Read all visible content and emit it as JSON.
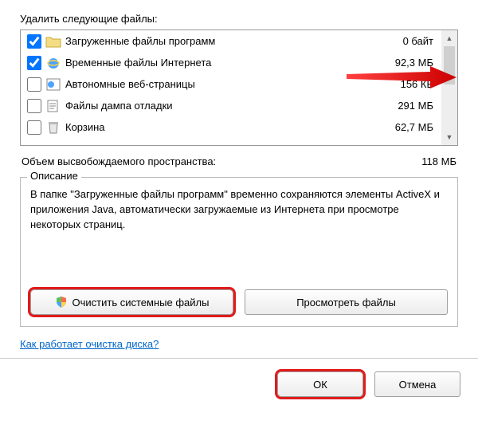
{
  "heading": "Удалить следующие файлы:",
  "files": [
    {
      "checked": true,
      "icon": "folder",
      "name": "Загруженные файлы программ",
      "size": "0 байт"
    },
    {
      "checked": true,
      "icon": "ie",
      "name": "Временные файлы Интернета",
      "size": "92,3 МБ"
    },
    {
      "checked": false,
      "icon": "web",
      "name": "Автономные веб-страницы",
      "size": "156 КБ"
    },
    {
      "checked": false,
      "icon": "dump",
      "name": "Файлы дампа отладки",
      "size": "291 МБ"
    },
    {
      "checked": false,
      "icon": "bin",
      "name": "Корзина",
      "size": "62,7 МБ"
    }
  ],
  "free_label": "Объем высвобождаемого пространства:",
  "free_value": "118 МБ",
  "group_title": "Описание",
  "description": "В папке \"Загруженные файлы программ\" временно сохраняются элементы ActiveX и приложения Java, автоматически загружаемые из Интернета при просмотре некоторых страниц.",
  "btn_clean": "Очистить системные файлы",
  "btn_view": "Просмотреть файлы",
  "link": "Как работает очистка диска?",
  "btn_ok": "ОК",
  "btn_cancel": "Отмена"
}
